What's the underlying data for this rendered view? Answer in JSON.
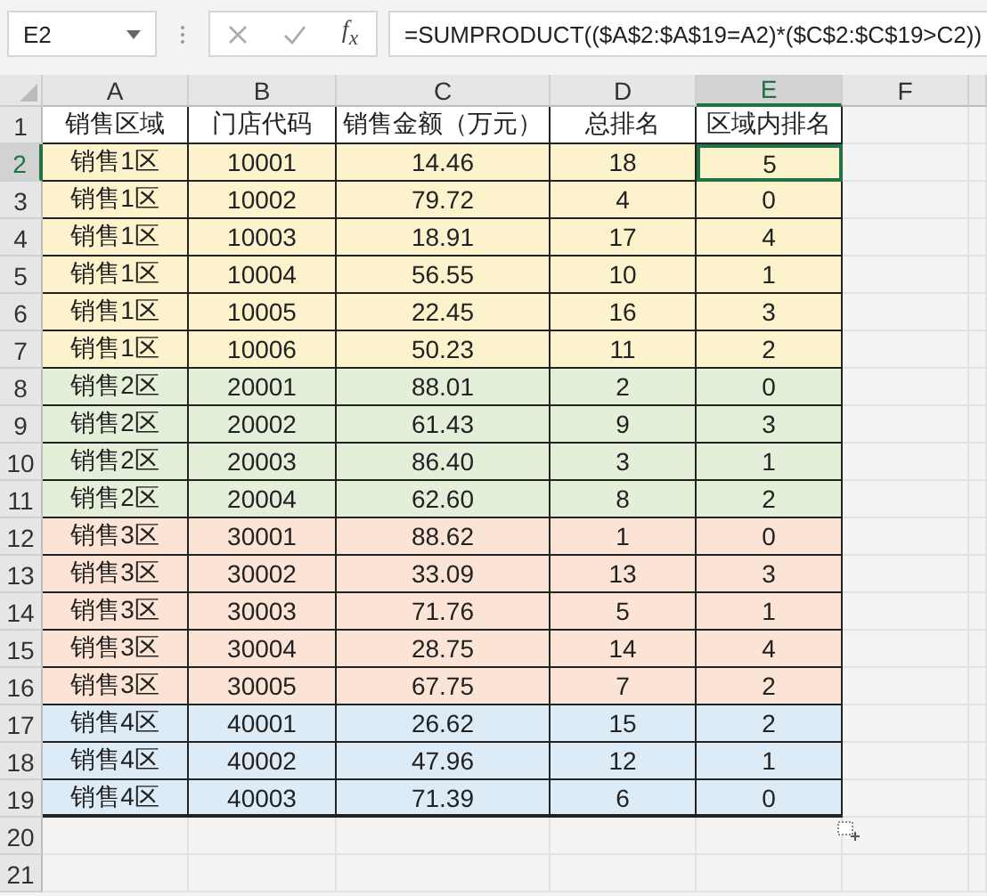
{
  "formula_bar": {
    "name_box": "E2",
    "fx_label": "f$_{x}$",
    "formula": "=SUMPRODUCT(($A$2:$A$19=A2)*($C$2:$C$19>C2))"
  },
  "sheet": {
    "columns": [
      {
        "label": "A",
        "selected": false
      },
      {
        "label": "B",
        "selected": false
      },
      {
        "label": "C",
        "selected": false
      },
      {
        "label": "D",
        "selected": false
      },
      {
        "label": "E",
        "selected": true
      },
      {
        "label": "F",
        "selected": false
      }
    ],
    "header_row": {
      "number": "1",
      "cells": [
        "销售区域",
        "门店代码",
        "销售金额（万元）",
        "总排名",
        "区域内排名"
      ]
    },
    "rows": [
      {
        "number": "2",
        "selected": true,
        "color": "#fcf3cd",
        "cells": [
          "销售1区",
          "10001",
          "14.46",
          "18",
          "5"
        ]
      },
      {
        "number": "3",
        "selected": false,
        "color": "#fcf3cd",
        "cells": [
          "销售1区",
          "10002",
          "79.72",
          "4",
          "0"
        ]
      },
      {
        "number": "4",
        "selected": false,
        "color": "#fcf3cd",
        "cells": [
          "销售1区",
          "10003",
          "18.91",
          "17",
          "4"
        ]
      },
      {
        "number": "5",
        "selected": false,
        "color": "#fcf3cd",
        "cells": [
          "销售1区",
          "10004",
          "56.55",
          "10",
          "1"
        ]
      },
      {
        "number": "6",
        "selected": false,
        "color": "#fcf3cd",
        "cells": [
          "销售1区",
          "10005",
          "22.45",
          "16",
          "3"
        ]
      },
      {
        "number": "7",
        "selected": false,
        "color": "#fcf3cd",
        "cells": [
          "销售1区",
          "10006",
          "50.23",
          "11",
          "2"
        ]
      },
      {
        "number": "8",
        "selected": false,
        "color": "#e3efd9",
        "cells": [
          "销售2区",
          "20001",
          "88.01",
          "2",
          "0"
        ]
      },
      {
        "number": "9",
        "selected": false,
        "color": "#e3efd9",
        "cells": [
          "销售2区",
          "20002",
          "61.43",
          "9",
          "3"
        ]
      },
      {
        "number": "10",
        "selected": false,
        "color": "#e3efd9",
        "cells": [
          "销售2区",
          "20003",
          "86.40",
          "3",
          "1"
        ]
      },
      {
        "number": "11",
        "selected": false,
        "color": "#e3efd9",
        "cells": [
          "销售2区",
          "20004",
          "62.60",
          "8",
          "2"
        ]
      },
      {
        "number": "12",
        "selected": false,
        "color": "#fbe3d5",
        "cells": [
          "销售3区",
          "30001",
          "88.62",
          "1",
          "0"
        ]
      },
      {
        "number": "13",
        "selected": false,
        "color": "#fbe3d5",
        "cells": [
          "销售3区",
          "30002",
          "33.09",
          "13",
          "3"
        ]
      },
      {
        "number": "14",
        "selected": false,
        "color": "#fbe3d5",
        "cells": [
          "销售3区",
          "30003",
          "71.76",
          "5",
          "1"
        ]
      },
      {
        "number": "15",
        "selected": false,
        "color": "#fbe3d5",
        "cells": [
          "销售3区",
          "30004",
          "28.75",
          "14",
          "4"
        ]
      },
      {
        "number": "16",
        "selected": false,
        "color": "#fbe3d5",
        "cells": [
          "销售3区",
          "30005",
          "67.75",
          "7",
          "2"
        ]
      },
      {
        "number": "17",
        "selected": false,
        "color": "#ddebf6",
        "cells": [
          "销售4区",
          "40001",
          "26.62",
          "15",
          "2"
        ]
      },
      {
        "number": "18",
        "selected": false,
        "color": "#ddebf6",
        "cells": [
          "销售4区",
          "40002",
          "47.96",
          "12",
          "1"
        ]
      },
      {
        "number": "19",
        "selected": false,
        "color": "#ddebf6",
        "cells": [
          "销售4区",
          "40003",
          "71.39",
          "6",
          "0"
        ]
      }
    ],
    "empty_rows": [
      "20",
      "21"
    ]
  }
}
